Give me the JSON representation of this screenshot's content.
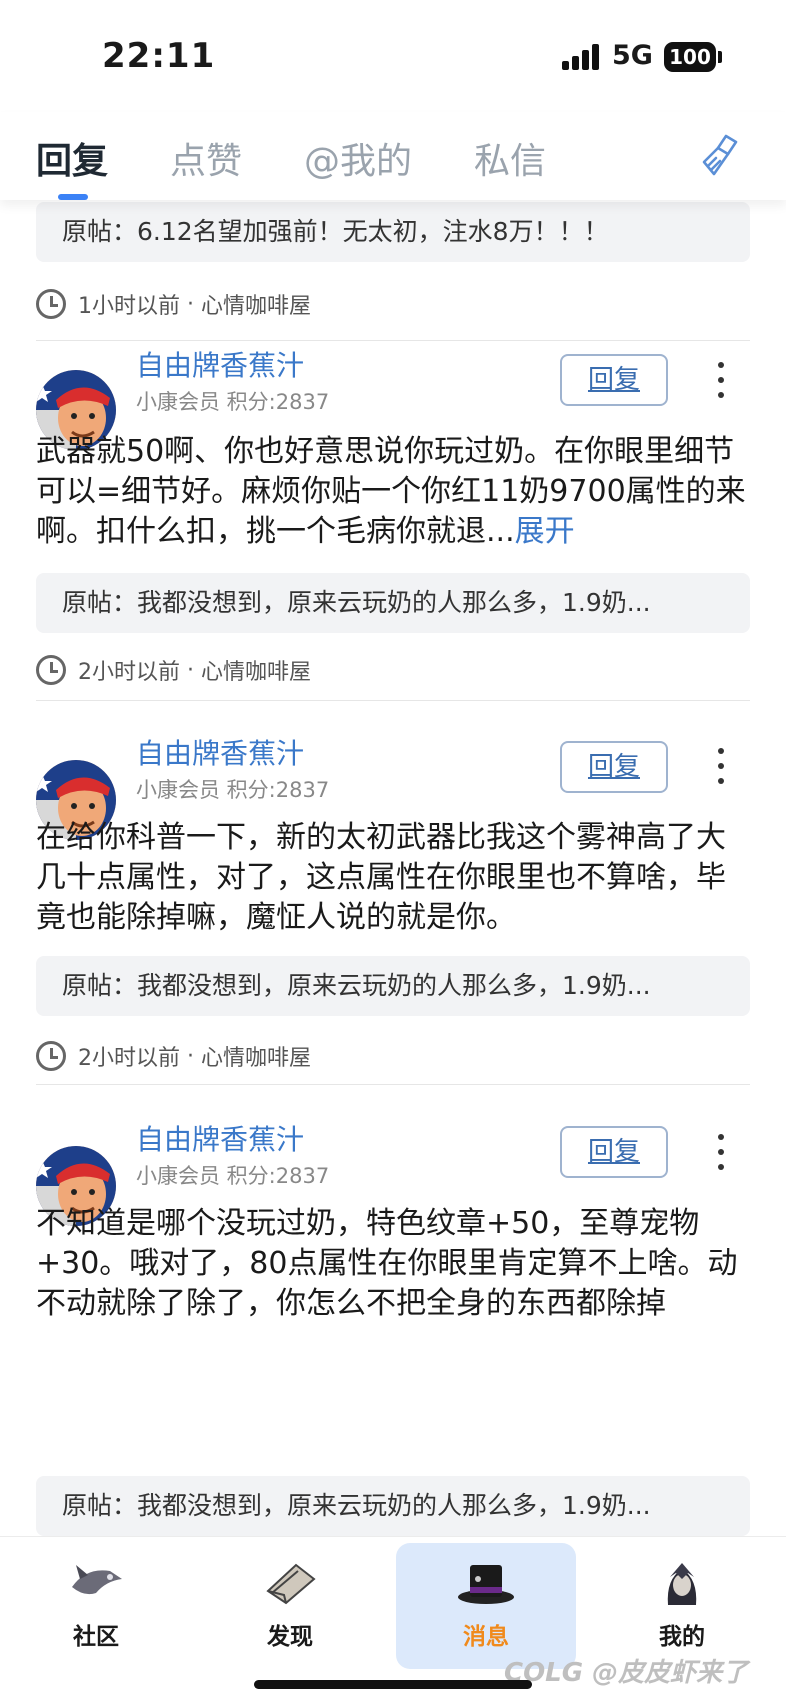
{
  "status": {
    "time": "22:11",
    "network": "5G",
    "battery": "100"
  },
  "tabs": [
    {
      "label": "回复",
      "active": true
    },
    {
      "label": "点赞",
      "active": false
    },
    {
      "label": "@我的",
      "active": false
    },
    {
      "label": "私信",
      "active": false
    }
  ],
  "top_partial": {
    "original": "原帖：6.12名望加强前！无太初，注水8万！！！",
    "time": "1小时以前",
    "forum": "心情咖啡屋"
  },
  "replies": [
    {
      "username": "自由牌香蕉汁",
      "level": "小康会员 积分:2837",
      "reply_label": "回复",
      "text": "武器就50啊、你也好意思说你玩过奶。在你眼里细节可以=细节好。麻烦你贴一个你红11奶9700属性的来啊。扣什么扣，挑一个毛病你就退...",
      "expand": "展开",
      "original": "原帖：我都没想到，原来云玩奶的人那么多，1.9奶...",
      "time": "2小时以前",
      "forum": "心情咖啡屋"
    },
    {
      "username": "自由牌香蕉汁",
      "level": "小康会员 积分:2837",
      "reply_label": "回复",
      "text": "在给你科普一下，新的太初武器比我这个雾神高了大几十点属性，对了，这点属性在你眼里也不算啥，毕竟也能除掉嘛，魔怔人说的就是你。",
      "original": "原帖：我都没想到，原来云玩奶的人那么多，1.9奶...",
      "time": "2小时以前",
      "forum": "心情咖啡屋"
    },
    {
      "username": "自由牌香蕉汁",
      "level": "小康会员 积分:2837",
      "reply_label": "回复",
      "text": "不知道是哪个没玩过奶，特色纹章+50，至尊宠物+30。哦对了，80点属性在你眼里肯定算不上啥。动不动就除了除了，你怎么不把全身的东西都除掉",
      "original": "原帖：我都没想到，原来云玩奶的人那么多，1.9奶..."
    }
  ],
  "nav": [
    {
      "label": "社区",
      "icon": "community-icon",
      "active": false
    },
    {
      "label": "发现",
      "icon": "discover-icon",
      "active": false
    },
    {
      "label": "消息",
      "icon": "message-icon",
      "active": true
    },
    {
      "label": "我的",
      "icon": "profile-icon",
      "active": false
    }
  ],
  "watermark": "COLG @皮皮虾来了",
  "colors": {
    "accent": "#3b82f6",
    "username": "#3a78c9",
    "active_nav": "#f08a1c"
  }
}
